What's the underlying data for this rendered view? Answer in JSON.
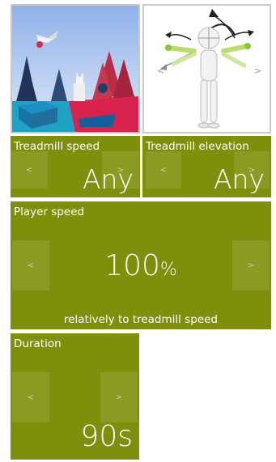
{
  "tiles": {
    "treadmill_speed": {
      "title": "Treadmill speed",
      "value": "Any",
      "prev": "<",
      "next": ">"
    },
    "treadmill_elevation": {
      "title": "Treadmill elevation",
      "value": "Any",
      "prev": "<",
      "next": ">"
    },
    "player_speed": {
      "title": "Player speed",
      "value": "100",
      "unit": "%",
      "subtitle": "relatively to treadmill speed",
      "prev": "<",
      "next": ">"
    },
    "duration": {
      "title": "Duration",
      "value": "90s",
      "prev": "<",
      "next": ">"
    }
  },
  "thumbnails": {
    "avatar_arrows": {
      "prev": "<",
      "next": ">"
    }
  },
  "colors": {
    "tile_green": "#7e8f0b",
    "text": "#ffffff"
  }
}
